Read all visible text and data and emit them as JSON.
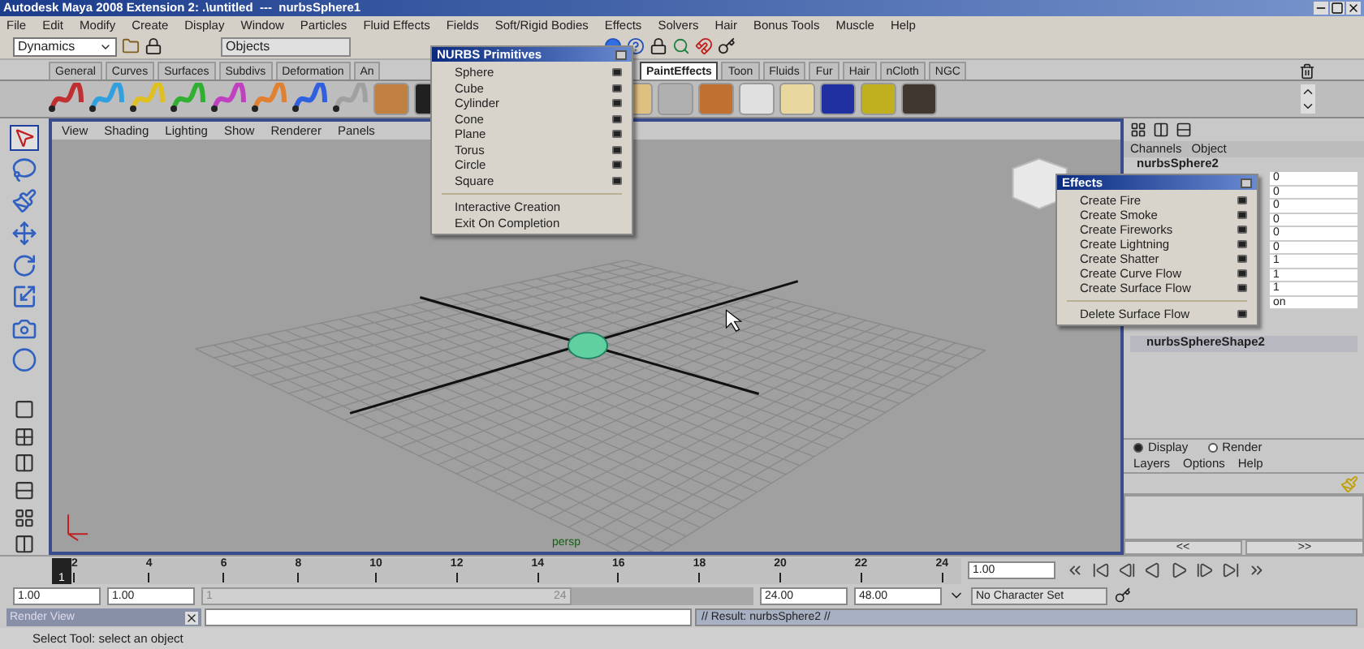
{
  "window": {
    "title": "Autodesk Maya 2008 Extension 2: .\\untitled  ---  nurbsSphere1"
  },
  "menu_bar": [
    "File",
    "Edit",
    "Modify",
    "Create",
    "Display",
    "Window",
    "Particles",
    "Fluid Effects",
    "Fields",
    "Soft/Rigid Bodies",
    "Effects",
    "Solvers",
    "Hair",
    "Bonus Tools",
    "Muscle",
    "Help"
  ],
  "status_line": {
    "menu_set": "Dynamics",
    "selection_mode": "Objects"
  },
  "shelf_tabs": [
    {
      "label": "General",
      "selected": false
    },
    {
      "label": "Curves",
      "selected": false
    },
    {
      "label": "Surfaces",
      "selected": false
    },
    {
      "label": "Subdivs",
      "selected": false
    },
    {
      "label": "Deformation",
      "selected": false
    },
    {
      "label": "An",
      "selected": false
    },
    {
      "label": "PaintEffects",
      "selected": true
    },
    {
      "label": "Toon",
      "selected": false
    },
    {
      "label": "Fluids",
      "selected": false
    },
    {
      "label": "Fur",
      "selected": false
    },
    {
      "label": "Hair",
      "selected": false
    },
    {
      "label": "nCloth",
      "selected": false
    },
    {
      "label": "NGC",
      "selected": false
    }
  ],
  "viewport": {
    "menu": [
      "View",
      "Shading",
      "Lighting",
      "Show",
      "Renderer",
      "Panels"
    ],
    "camera": "persp"
  },
  "nurbs_menu": {
    "title": "NURBS Primitives",
    "items": [
      "Sphere",
      "Cube",
      "Cylinder",
      "Cone",
      "Plane",
      "Torus",
      "Circle",
      "Square"
    ],
    "toggles": [
      "Interactive Creation",
      "Exit On Completion"
    ]
  },
  "effects_menu": {
    "title": "Effects",
    "items": [
      "Create Fire",
      "Create Smoke",
      "Create Fireworks",
      "Create Lightning",
      "Create Shatter",
      "Create Curve Flow",
      "Create Surface Flow"
    ],
    "extra_items": [
      "Delete Surface Flow"
    ]
  },
  "channel_box": {
    "tabs": [
      "Channels",
      "Object"
    ],
    "node": "nurbsSphere2",
    "values": [
      "0",
      "0",
      "0",
      "0",
      "0",
      "0",
      "1",
      "1",
      "1",
      "on"
    ],
    "shape": "nurbsSphereShape2"
  },
  "layer_editor": {
    "modes": [
      {
        "label": "Display",
        "selected": true
      },
      {
        "label": "Render",
        "selected": false
      }
    ],
    "menu": [
      "Layers",
      "Options",
      "Help"
    ],
    "scroll_buttons": [
      "<<",
      ">>"
    ]
  },
  "time_slider": {
    "level": 0,
    "current_frame": "1",
    "ticks": [
      "2",
      "4",
      "6",
      "8",
      "10",
      "12",
      "14",
      "16",
      "18",
      "20",
      "22",
      "24"
    ],
    "current_time": "1.00"
  },
  "range_slider": {
    "level": 0.67,
    "start": "1.00",
    "playback_start": "1.00",
    "range_start": "1",
    "range_end": "24",
    "playback_end": "24.00",
    "end": "48.00",
    "character_set": "No Character Set"
  },
  "command_line": {
    "render_view_title": "Render View",
    "result": "// Result: nurbsSphere2 //"
  },
  "help_line": "Select Tool: select an object"
}
